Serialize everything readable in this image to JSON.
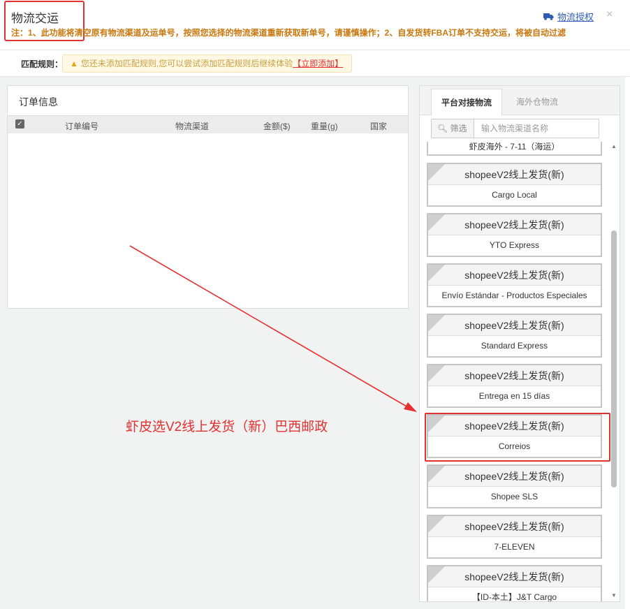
{
  "dialog": {
    "title": "物流交运",
    "note": "注：1、此功能将清空原有物流渠道及运单号，按照您选择的物流渠道重新获取新单号，请谨慎操作；2、自发货转FBA订单不支持交运，将被自动过滤",
    "auth_link": "物流授权",
    "close": "×"
  },
  "rules": {
    "label": "匹配规则：",
    "warning": "您还未添加匹配规则,您可以尝试添加匹配规则后继续体验",
    "add_link": "【立即添加】"
  },
  "order_panel": {
    "title": "订单信息",
    "columns": [
      "订单编号",
      "物流渠道",
      "金额($)",
      "重量(g)",
      "国家"
    ],
    "rows": []
  },
  "logistics_panel": {
    "tabs": [
      "平台对接物流",
      "海外仓物流"
    ],
    "active_tab": "平台对接物流",
    "filter": {
      "label": "筛选",
      "placeholder": "输入物流渠道名称",
      "value": ""
    },
    "partial_top": "虾皮海外 - 7-11（海运）",
    "cards": [
      {
        "title": "shopeeV2线上发货(新)",
        "subtitle": "Cargo Local"
      },
      {
        "title": "shopeeV2线上发货(新)",
        "subtitle": "YTO Express"
      },
      {
        "title": "shopeeV2线上发货(新)",
        "subtitle": "Envío Estándar - Productos Especiales"
      },
      {
        "title": "shopeeV2线上发货(新)",
        "subtitle": "Standard Express"
      },
      {
        "title": "shopeeV2线上发货(新)",
        "subtitle": "Entrega en 15 días"
      },
      {
        "title": "shopeeV2线上发货(新)",
        "subtitle": "Correios"
      },
      {
        "title": "shopeeV2线上发货(新)",
        "subtitle": "Shopee SLS"
      },
      {
        "title": "shopeeV2线上发货(新)",
        "subtitle": "7-ELEVEN"
      },
      {
        "title": "shopeeV2线上发货(新)",
        "subtitle": "【ID-本土】J&T Cargo"
      }
    ]
  },
  "annotation": {
    "text": "虾皮选V2线上发货（新）巴西邮政",
    "color": "#e53030"
  },
  "colors": {
    "accent_red": "#e53030",
    "warning_text": "#c9780e",
    "link_blue": "#2f5db4"
  }
}
